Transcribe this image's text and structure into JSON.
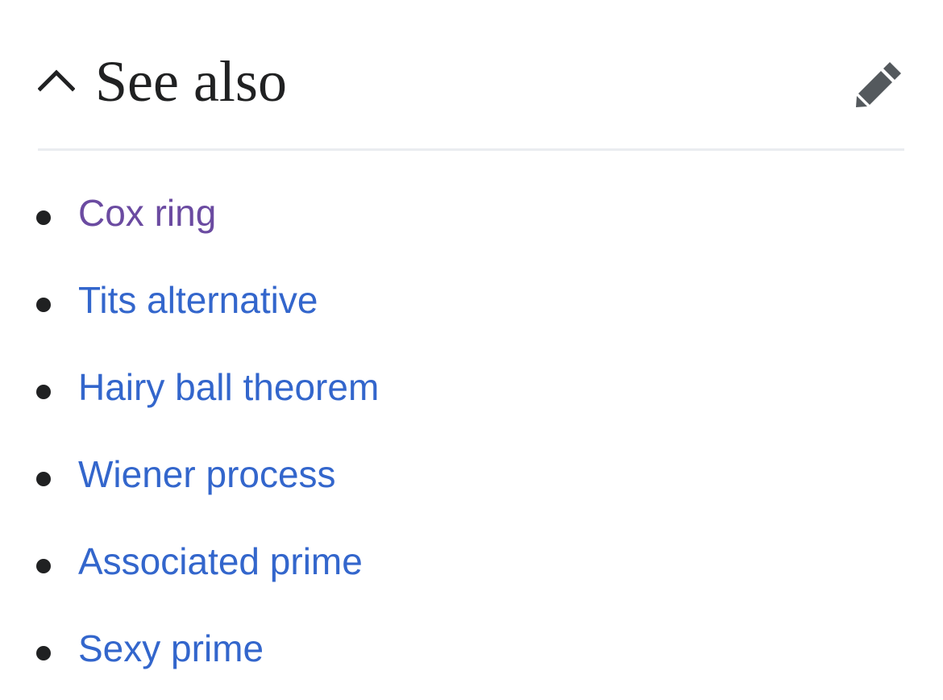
{
  "section": {
    "title": "See also",
    "toggle_icon": "chevron-up-icon",
    "edit_icon": "pencil-icon"
  },
  "colors": {
    "link": "#3366cc",
    "visited_link": "#6b4ba1",
    "text": "#202122",
    "icon": "#54595d",
    "divider": "#eaecf0"
  },
  "links": [
    {
      "label": "Cox ring",
      "visited": true
    },
    {
      "label": "Tits alternative",
      "visited": false
    },
    {
      "label": "Hairy ball theorem",
      "visited": false
    },
    {
      "label": "Wiener process",
      "visited": false
    },
    {
      "label": "Associated prime",
      "visited": false
    },
    {
      "label": "Sexy prime",
      "visited": false
    }
  ]
}
